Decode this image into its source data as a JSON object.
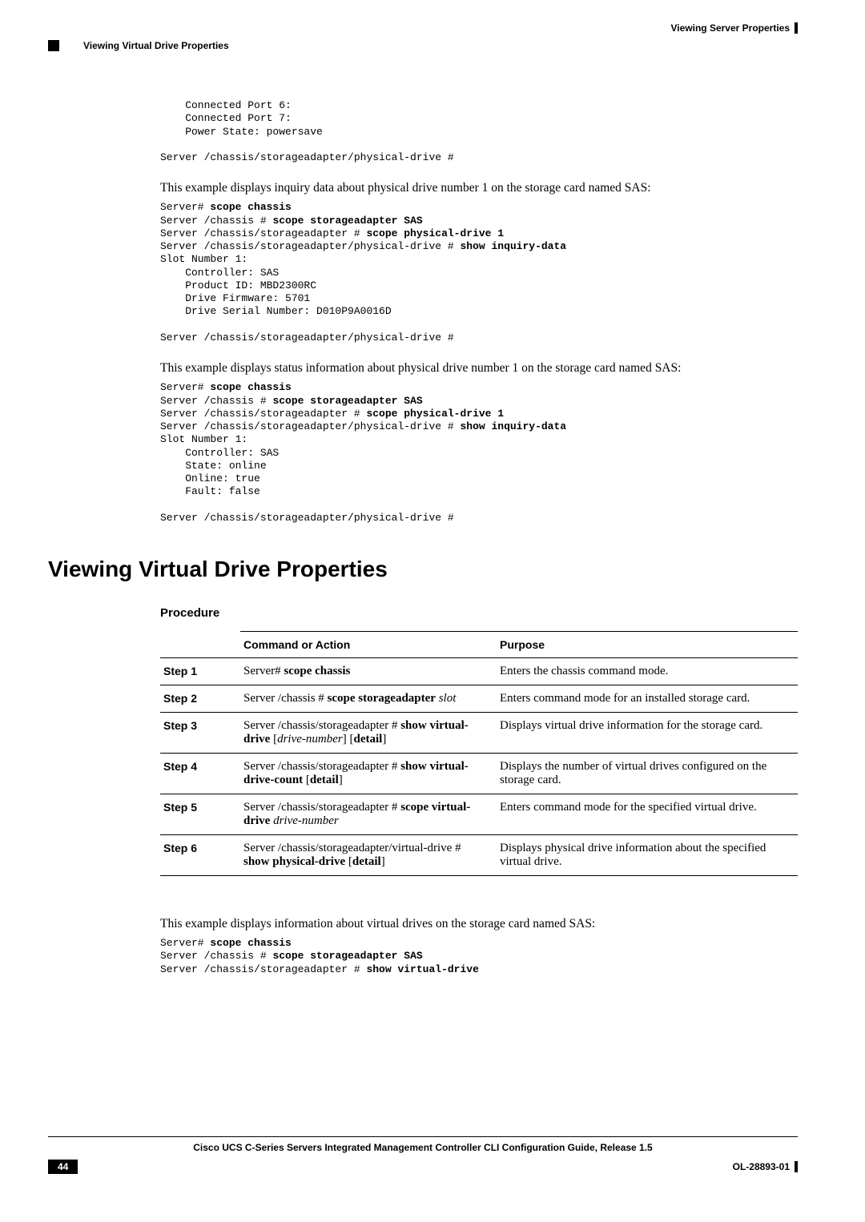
{
  "header": {
    "right_title": "Viewing Server Properties",
    "breadcrumb": "Viewing Virtual Drive Properties"
  },
  "intro1": "This example displays inquiry data about physical drive number 1 on the storage card named SAS:",
  "intro2": "This example displays status information about physical drive number 1 on the storage card named SAS:",
  "intro3": "This example displays information about virtual drives on the storage card named SAS:",
  "section_title": "Viewing Virtual Drive Properties",
  "procedure_label": "Procedure",
  "table_headers": {
    "col2": "Command or Action",
    "col3": "Purpose"
  },
  "steps": [
    {
      "label": "Step 1",
      "cmd_prefix": "Server# ",
      "cmd_bold": "scope chassis",
      "cmd_suffix": "",
      "purpose": "Enters the chassis command mode."
    },
    {
      "label": "Step 2",
      "cmd_prefix": "Server /chassis # ",
      "cmd_bold": "scope storageadapter",
      "cmd_ital": " slot",
      "purpose": "Enters command mode for an installed storage card."
    },
    {
      "label": "Step 3",
      "cmd_prefix": "Server /chassis/storageadapter # ",
      "cmd_bold": "show virtual-drive",
      "cmd_optional": " [drive-number] [detail]",
      "purpose": "Displays virtual drive information for the storage card."
    },
    {
      "label": "Step 4",
      "cmd_prefix": "Server /chassis/storageadapter # ",
      "cmd_bold": "show virtual-drive-count",
      "cmd_optional2": " [detail]",
      "purpose": "Displays the number of virtual drives configured on the storage card."
    },
    {
      "label": "Step 5",
      "cmd_prefix": "Server /chassis/storageadapter # ",
      "cmd_bold": "scope virtual-drive",
      "cmd_ital": " drive-number",
      "purpose": "Enters command mode for the specified virtual drive."
    },
    {
      "label": "Step 6",
      "cmd_prefix": "Server /chassis/storageadapter/virtual-drive # ",
      "cmd_bold": "show physical-drive",
      "cmd_optional2": " [detail]",
      "purpose": "Displays physical drive information about the specified virtual drive."
    }
  ],
  "footer": {
    "guide": "Cisco UCS C-Series Servers Integrated Management Controller CLI Configuration Guide, Release 1.5",
    "page": "44",
    "doc_code": "OL-28893-01"
  },
  "code": {
    "block0_l1": "    Connected Port 6:",
    "block0_l2": "    Connected Port 7:",
    "block0_l3": "    Power State: powersave",
    "block0_l4": "",
    "block0_l5": "Server /chassis/storageadapter/physical-drive #",
    "block1_l1a": "Server# ",
    "block1_l1b": "scope chassis",
    "block1_l2a": "Server /chassis # ",
    "block1_l2b": "scope storageadapter SAS",
    "block1_l3a": "Server /chassis/storageadapter # ",
    "block1_l3b": "scope physical-drive 1",
    "block1_l4a": "Server /chassis/storageadapter/physical-drive # ",
    "block1_l4b": "show inquiry-data",
    "block1_l5": "Slot Number 1:",
    "block1_l6": "    Controller: SAS",
    "block1_l7": "    Product ID: MBD2300RC",
    "block1_l8": "    Drive Firmware: 5701",
    "block1_l9": "    Drive Serial Number: D010P9A0016D",
    "block1_l10": "",
    "block1_l11": "Server /chassis/storageadapter/physical-drive #",
    "block2_l1a": "Server# ",
    "block2_l1b": "scope chassis",
    "block2_l2a": "Server /chassis # ",
    "block2_l2b": "scope storageadapter SAS",
    "block2_l3a": "Server /chassis/storageadapter # ",
    "block2_l3b": "scope physical-drive 1",
    "block2_l4a": "Server /chassis/storageadapter/physical-drive # ",
    "block2_l4b": "show inquiry-data",
    "block2_l5": "Slot Number 1:",
    "block2_l6": "    Controller: SAS",
    "block2_l7": "    State: online",
    "block2_l8": "    Online: true",
    "block2_l9": "    Fault: false",
    "block2_l10": "",
    "block2_l11": "Server /chassis/storageadapter/physical-drive #",
    "block3_l1a": "Server# ",
    "block3_l1b": "scope chassis",
    "block3_l2a": "Server /chassis # ",
    "block3_l2b": "scope storageadapter SAS",
    "block3_l3a": "Server /chassis/storageadapter # ",
    "block3_l3b": "show virtual-drive"
  }
}
